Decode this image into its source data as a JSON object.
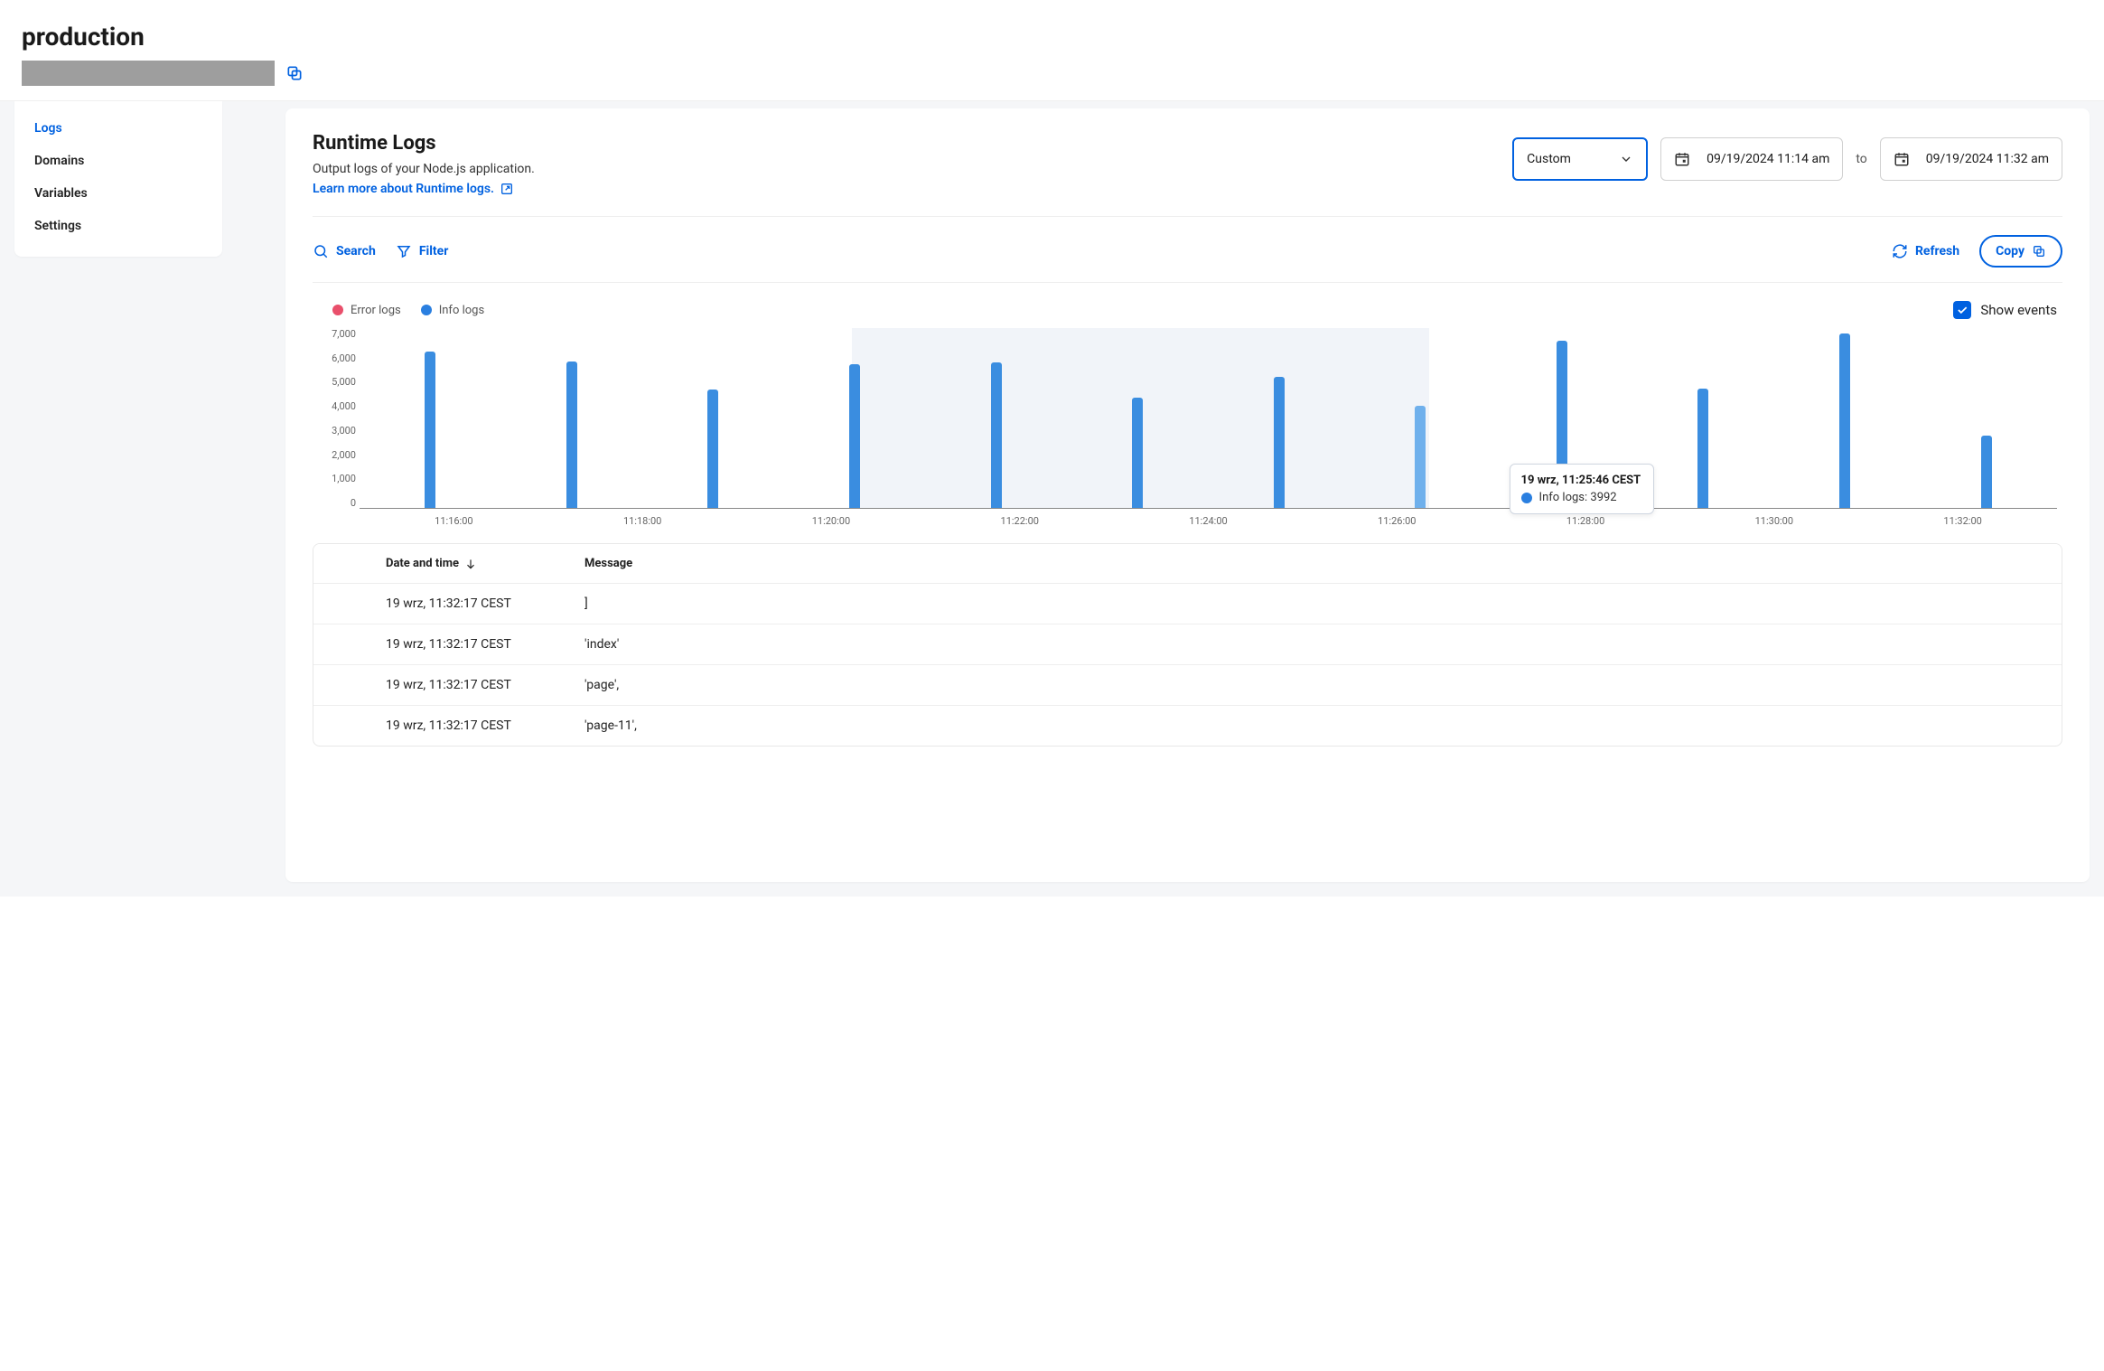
{
  "header": {
    "title": "production"
  },
  "sidebar": {
    "items": [
      {
        "label": "Logs",
        "active": true
      },
      {
        "label": "Domains",
        "active": false
      },
      {
        "label": "Variables",
        "active": false
      },
      {
        "label": "Settings",
        "active": false
      }
    ]
  },
  "panel": {
    "title": "Runtime Logs",
    "subtitle": "Output logs of your Node.js application.",
    "learn_more": "Learn more about Runtime logs."
  },
  "time": {
    "range_label": "Custom",
    "from": "09/19/2024 11:14 am",
    "to_word": "to",
    "to": "09/19/2024 11:32 am"
  },
  "toolbar": {
    "search": "Search",
    "filter": "Filter",
    "refresh": "Refresh",
    "copy": "Copy"
  },
  "legend": {
    "error": "Error logs",
    "info": "Info logs",
    "show_events": "Show events",
    "show_events_checked": true
  },
  "tooltip": {
    "title": "19 wrz, 11:25:46 CEST",
    "series": "Info logs",
    "value": "3992"
  },
  "chart_data": {
    "type": "bar",
    "ylabel": "",
    "xlabel": "",
    "ylim": [
      0,
      7000
    ],
    "y_ticks": [
      "7,000",
      "6,000",
      "5,000",
      "4,000",
      "3,000",
      "2,000",
      "1,000",
      "0"
    ],
    "x_ticks": [
      "11:16:00",
      "11:18:00",
      "11:20:00",
      "11:22:00",
      "11:24:00",
      "11:26:00",
      "11:28:00",
      "11:30:00",
      "11:32:00"
    ],
    "series": [
      {
        "name": "Error logs",
        "color": "#e94f6b",
        "values": []
      },
      {
        "name": "Info logs",
        "color": "#2a7fe0",
        "values": [
          6100,
          5700,
          4600,
          5600,
          5650,
          4300,
          5100,
          3992,
          6500,
          4650,
          6800,
          2800
        ]
      }
    ],
    "highlight_index": 7,
    "selection_band": {
      "start_frac": 0.29,
      "end_frac": 0.63
    }
  },
  "table": {
    "columns": {
      "date": "Date and time",
      "message": "Message"
    },
    "rows": [
      {
        "date": "19 wrz, 11:32:17 CEST",
        "message": "]"
      },
      {
        "date": "19 wrz, 11:32:17 CEST",
        "message": "'index'"
      },
      {
        "date": "19 wrz, 11:32:17 CEST",
        "message": "'page',"
      },
      {
        "date": "19 wrz, 11:32:17 CEST",
        "message": "'page-11',"
      }
    ]
  }
}
